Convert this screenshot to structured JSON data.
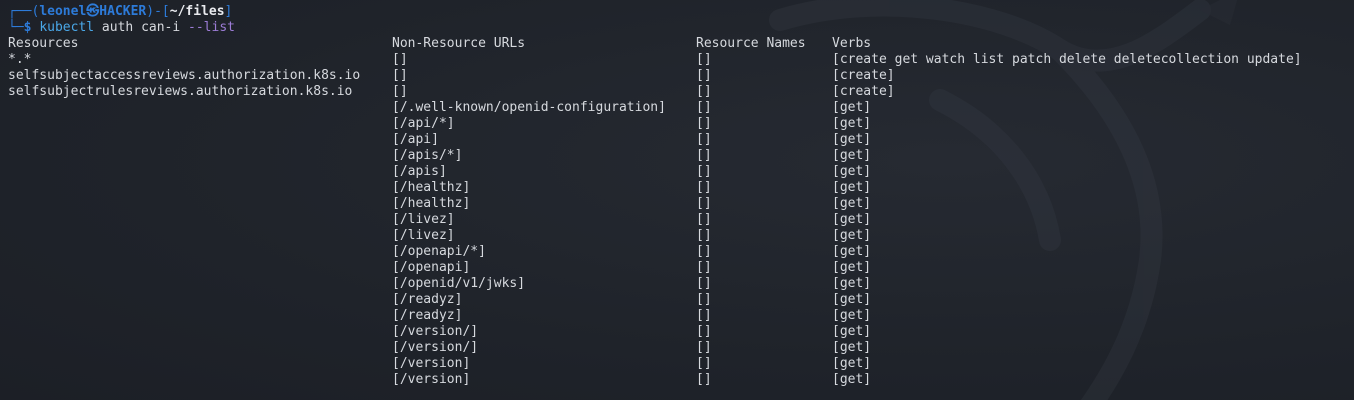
{
  "prompt": {
    "box_top": "┌──(",
    "user": "leonel",
    "at_symbol": "㉿",
    "host": "HACKER",
    "sep": ")-[",
    "path": "~/files",
    "close": "]",
    "box_bottom": "└─",
    "dollar": "$ ",
    "command": "kubectl",
    "args": " auth can-i ",
    "flag": "--list"
  },
  "headers": {
    "resources": "Resources",
    "non_resource_urls": "Non-Resource URLs",
    "resource_names": "Resource Names",
    "verbs": "Verbs"
  },
  "rows": [
    {
      "resources": "*.*",
      "urls": "[]",
      "names": "[]",
      "verbs": "[create get watch list patch delete deletecollection update]"
    },
    {
      "resources": "selfsubjectaccessreviews.authorization.k8s.io",
      "urls": "[]",
      "names": "[]",
      "verbs": "[create]"
    },
    {
      "resources": "selfsubjectrulesreviews.authorization.k8s.io",
      "urls": "[]",
      "names": "[]",
      "verbs": "[create]"
    },
    {
      "resources": "",
      "urls": "[/.well-known/openid-configuration]",
      "names": "[]",
      "verbs": "[get]"
    },
    {
      "resources": "",
      "urls": "[/api/*]",
      "names": "[]",
      "verbs": "[get]"
    },
    {
      "resources": "",
      "urls": "[/api]",
      "names": "[]",
      "verbs": "[get]"
    },
    {
      "resources": "",
      "urls": "[/apis/*]",
      "names": "[]",
      "verbs": "[get]"
    },
    {
      "resources": "",
      "urls": "[/apis]",
      "names": "[]",
      "verbs": "[get]"
    },
    {
      "resources": "",
      "urls": "[/healthz]",
      "names": "[]",
      "verbs": "[get]"
    },
    {
      "resources": "",
      "urls": "[/healthz]",
      "names": "[]",
      "verbs": "[get]"
    },
    {
      "resources": "",
      "urls": "[/livez]",
      "names": "[]",
      "verbs": "[get]"
    },
    {
      "resources": "",
      "urls": "[/livez]",
      "names": "[]",
      "verbs": "[get]"
    },
    {
      "resources": "",
      "urls": "[/openapi/*]",
      "names": "[]",
      "verbs": "[get]"
    },
    {
      "resources": "",
      "urls": "[/openapi]",
      "names": "[]",
      "verbs": "[get]"
    },
    {
      "resources": "",
      "urls": "[/openid/v1/jwks]",
      "names": "[]",
      "verbs": "[get]"
    },
    {
      "resources": "",
      "urls": "[/readyz]",
      "names": "[]",
      "verbs": "[get]"
    },
    {
      "resources": "",
      "urls": "[/readyz]",
      "names": "[]",
      "verbs": "[get]"
    },
    {
      "resources": "",
      "urls": "[/version/]",
      "names": "[]",
      "verbs": "[get]"
    },
    {
      "resources": "",
      "urls": "[/version/]",
      "names": "[]",
      "verbs": "[get]"
    },
    {
      "resources": "",
      "urls": "[/version]",
      "names": "[]",
      "verbs": "[get]"
    },
    {
      "resources": "",
      "urls": "[/version]",
      "names": "[]",
      "verbs": "[get]"
    }
  ],
  "colors": {
    "background": "#20242b",
    "prompt_blue": "#2d7bd9",
    "command": "#4aa8e8",
    "flag": "#9c7cd6",
    "text": "#d6d9de"
  }
}
